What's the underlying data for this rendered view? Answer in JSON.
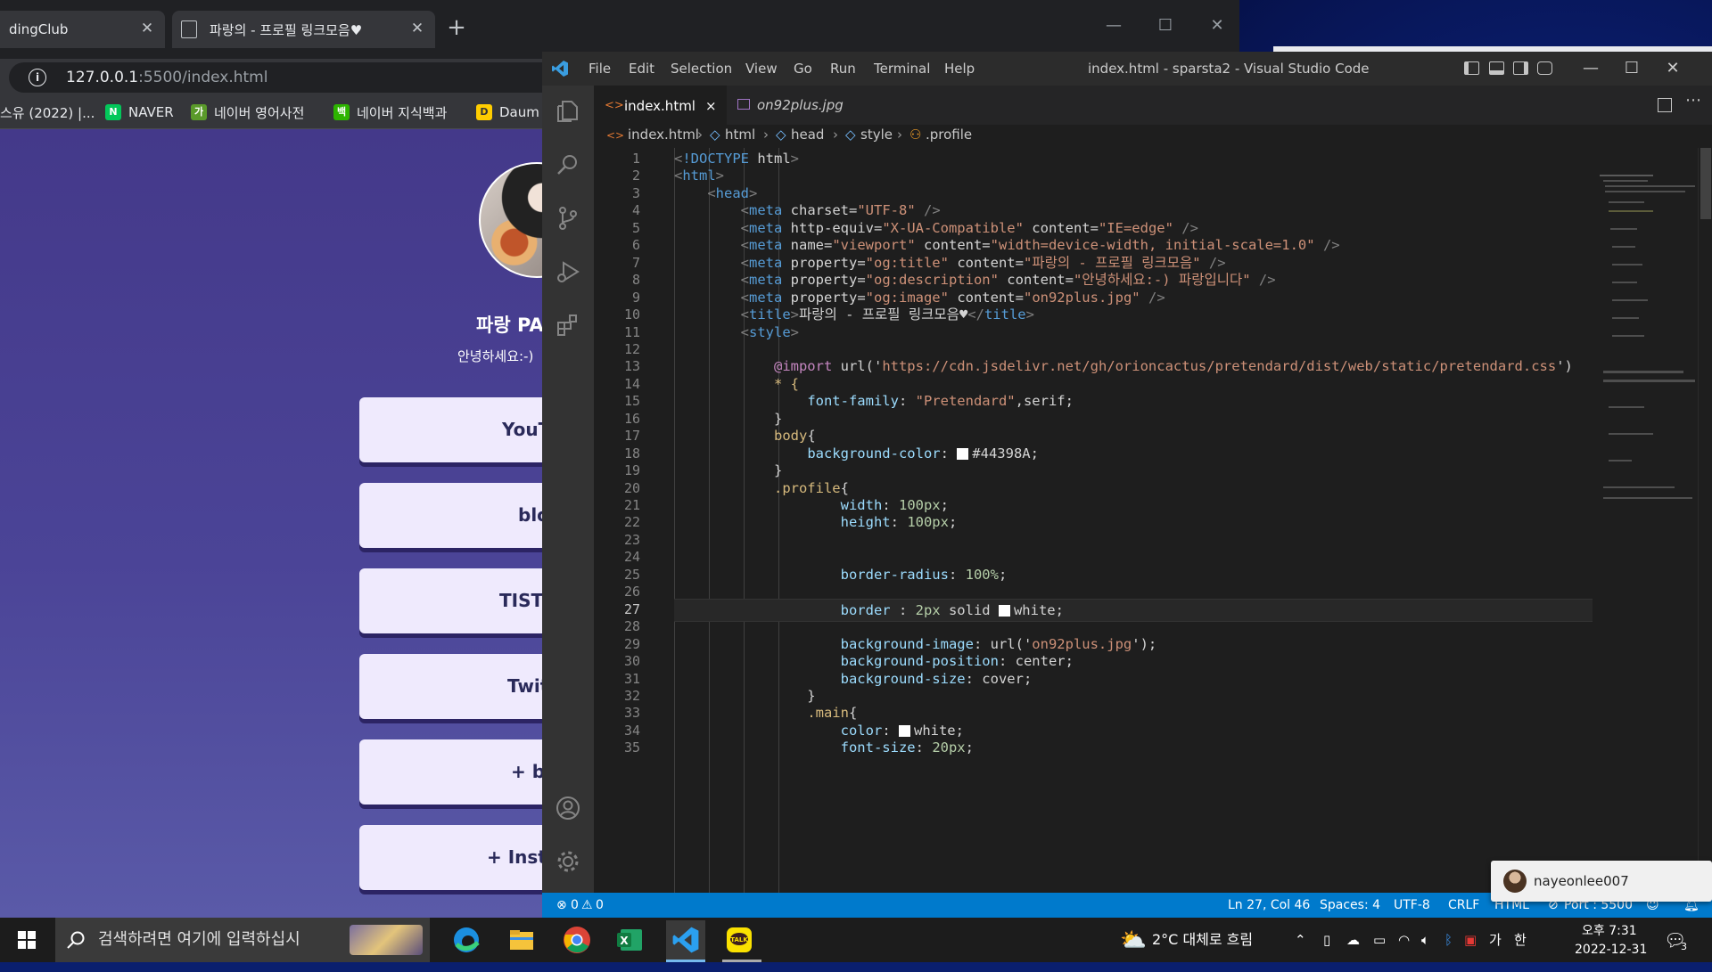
{
  "browser": {
    "tabs": [
      {
        "label": "dingClub"
      },
      {
        "label": "파랑의 - 프로필 링크모음♥"
      }
    ],
    "address": {
      "host": "127.0.0.1",
      "rest": ":5500/index.html"
    },
    "bookmarks": [
      {
        "label": "스유 (2022) |..."
      },
      {
        "label": "NAVER",
        "icon": "N",
        "color": "#03c75a"
      },
      {
        "label": "네이버 영어사전",
        "icon": "가",
        "color": "#5a9a2a"
      },
      {
        "label": "네이버 지식백과",
        "icon": "백",
        "color": "#2db400"
      },
      {
        "label": "Daum",
        "icon": "D",
        "color": "#ffcd00"
      }
    ],
    "page": {
      "name": "파랑 PA",
      "intro": "안녕하세요:-)",
      "links": [
        "YouT",
        "blo",
        "TIST",
        "Twit",
        "+ bl",
        "+ Insta"
      ]
    }
  },
  "vscode": {
    "menu": [
      "File",
      "Edit",
      "Selection",
      "View",
      "Go",
      "Run",
      "Terminal",
      "Help"
    ],
    "window_title": "index.html - sparsta2 - Visual Studio Code",
    "tabs": [
      {
        "label": "index.html",
        "close": "×"
      },
      {
        "label": "on92plus.jpg"
      }
    ],
    "breadcrumb": [
      "index.html",
      "html",
      "head",
      "style",
      ".profile"
    ],
    "code_lines": [
      "<!DOCTYPE html>",
      "<html>",
      "    <head>",
      "        <meta charset=\"UTF-8\" />",
      "        <meta http-equiv=\"X-UA-Compatible\" content=\"IE=edge\" />",
      "        <meta name=\"viewport\" content=\"width=device-width, initial-scale=1.0\" />",
      "        <meta property=\"og:title\" content=\"파랑의 - 프로필 링크모음\" />",
      "        <meta property=\"og:description\" content=\"안녕하세요:-) 파랑입니다\" />",
      "        <meta property=\"og:image\" content=\"on92plus.jpg\" />",
      "        <title>파랑의 - 프로필 링크모음♥</title>",
      "        <style>",
      "",
      "            @import url('https://cdn.jsdelivr.net/gh/orioncactus/pretendard/dist/web/static/pretendard.css')",
      "            * {",
      "                font-family: \"Pretendard\",serif;",
      "            }",
      "            body{",
      "                background-color: ■#44398A;",
      "            }",
      "            .profile{",
      "                    width: 100px;",
      "                    height: 100px;",
      "",
      "",
      "                    border-radius: 100%;",
      "",
      "                    border : 2px solid ■white;",
      "",
      "                    background-image: url('on92plus.jpg');",
      "                    background-position: center;",
      "                    background-size: cover;",
      "                }",
      "                .main{",
      "                    color: ■white;",
      "                    font-size: 20px;"
    ],
    "line_numbers": [
      "1",
      "2",
      "3",
      "4",
      "5",
      "6",
      "7",
      "8",
      "9",
      "10",
      "11",
      "12",
      "13",
      "14",
      "15",
      "16",
      "17",
      "18",
      "19",
      "20",
      "21",
      "22",
      "23",
      "24",
      "25",
      "26",
      "27",
      "28",
      "29",
      "30",
      "31",
      "32",
      "33",
      "34",
      "35"
    ],
    "status": {
      "errors": "0",
      "warnings": "0",
      "position": "Ln 27, Col 46",
      "spaces": "Spaces: 4",
      "encoding": "UTF-8",
      "eol": "CRLF",
      "language": "HTML",
      "port": "Port : 5500"
    },
    "toast_user": "nayeonlee007"
  },
  "taskbar": {
    "search_placeholder": "검색하려면 여기에 입력하십시",
    "weather": "2°C 대체로 흐림",
    "ime1": "가",
    "ime2": "한",
    "time": "오후 7:31",
    "date": "2022-12-31",
    "notif_count": "3"
  },
  "colors": {
    "accent": "#007acc",
    "page_bg": "#44398A"
  }
}
